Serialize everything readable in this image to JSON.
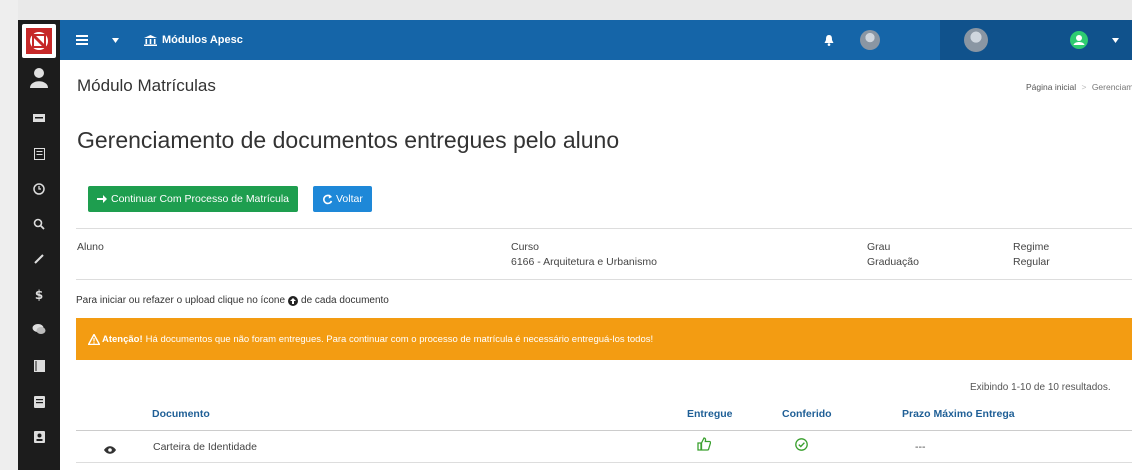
{
  "topbar": {
    "menu_icon": "hamburger-icon",
    "dropdown_icon": "caret-down-icon",
    "module_icon": "institution-icon",
    "module_label": "Módulos Apesc",
    "bell_icon": "bell-icon",
    "accent": "#1565a8",
    "accent_dark": "#10528c"
  },
  "sidebar": {
    "background": "#1c1c1c",
    "icons": [
      "user-icon",
      "id-card-icon",
      "document-icon",
      "clock-icon",
      "search-icon",
      "pencil-icon",
      "dollar-icon",
      "chat-icon",
      "book-icon",
      "file-icon",
      "contact-card-icon"
    ]
  },
  "page": {
    "module_title": "Módulo Matrículas",
    "breadcrumb_home": "Página inicial",
    "breadcrumb_sep": ">",
    "breadcrumb_current": "Gerenciamento",
    "heading": "Gerenciamento de documentos entregues pelo aluno"
  },
  "buttons": {
    "continue_label": "Continuar Com Processo de Matrícula",
    "continue_color": "#1e9e4f",
    "back_label": "Voltar",
    "back_color": "#1e88d8"
  },
  "student_info": {
    "aluno_label": "Aluno",
    "curso_label": "Curso",
    "curso_value": "6166 - Arquitetura e Urbanismo",
    "grau_label": "Grau",
    "grau_value": "Graduação",
    "regime_label": "Regime",
    "regime_value": "Regular"
  },
  "instructions": {
    "before": "Para iniciar ou refazer o upload clique no ícone",
    "after": "de cada documento"
  },
  "alert": {
    "strong": "Atenção!",
    "message": "Há documentos que não foram entregues. Para continuar com o processo de matrícula é necessário entreguá-los todos!",
    "color": "#f39c12"
  },
  "table": {
    "summary": "Exibindo 1-10 de 10 resultados.",
    "headers": {
      "documento": "Documento",
      "entregue": "Entregue",
      "conferido": "Conferido",
      "prazo": "Prazo Máximo Entrega"
    },
    "rows": [
      {
        "documento": "Carteira de Identidade",
        "prazo": "---"
      }
    ]
  }
}
